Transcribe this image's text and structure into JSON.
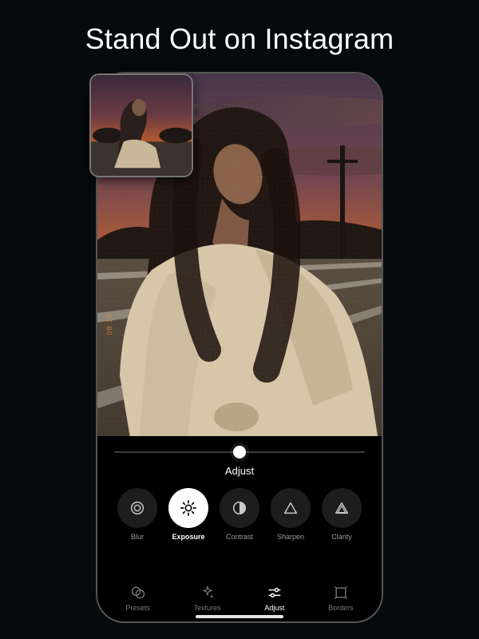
{
  "headline": "Stand Out on Instagram",
  "photo": {
    "date_stamp": "08 16"
  },
  "editor": {
    "slider": {
      "label": "Adjust",
      "position_pct": 50
    },
    "tools": [
      {
        "id": "blur",
        "label": "Blur",
        "active": false
      },
      {
        "id": "exposure",
        "label": "Exposure",
        "active": true
      },
      {
        "id": "contrast",
        "label": "Contrast",
        "active": false
      },
      {
        "id": "sharpen",
        "label": "Sharpen",
        "active": false
      },
      {
        "id": "clarity",
        "label": "Clarity",
        "active": false
      }
    ],
    "tabs": [
      {
        "id": "presets",
        "label": "Presets",
        "active": false
      },
      {
        "id": "textures",
        "label": "Textures",
        "active": false
      },
      {
        "id": "adjust",
        "label": "Adjust",
        "active": true
      },
      {
        "id": "borders",
        "label": "Borders",
        "active": false
      }
    ]
  },
  "colors": {
    "accent": "#ffffff",
    "bg": "#050a0c"
  }
}
